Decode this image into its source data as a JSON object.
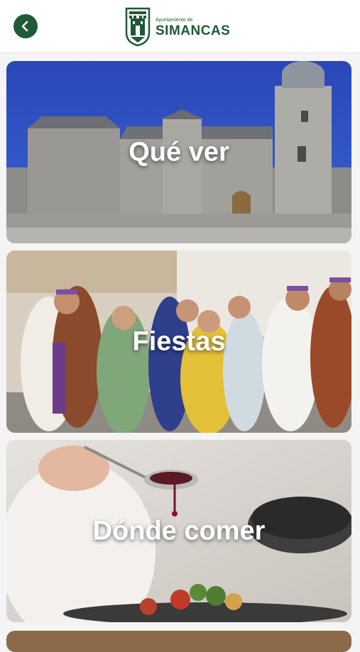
{
  "header": {
    "logo_small": "Ayuntamiento de",
    "logo_big": "SIMANCAS"
  },
  "cards": [
    {
      "label": "Qué ver"
    },
    {
      "label": "Fiestas"
    },
    {
      "label": "Dónde comer"
    }
  ],
  "colors": {
    "brand_green": "#1f5a34",
    "background": "#f4f4f4"
  },
  "icons": {
    "back": "chevron-left-icon",
    "logo": "castle-shield-icon"
  }
}
